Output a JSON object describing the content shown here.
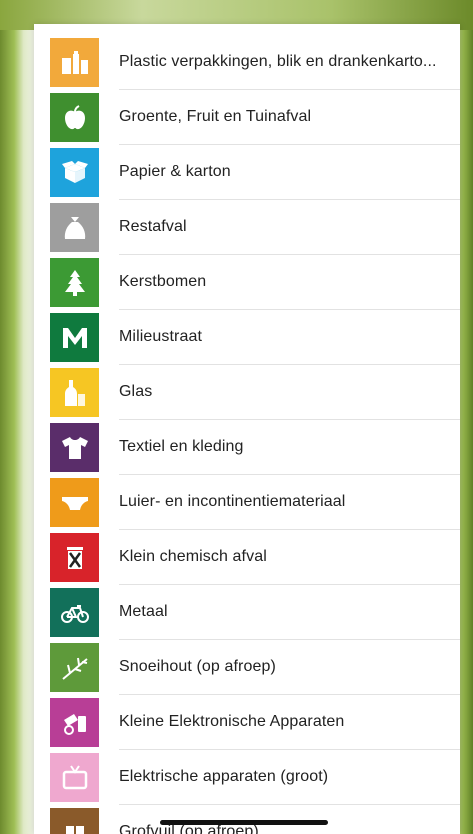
{
  "items": [
    {
      "label": "Plastic verpakkingen, blik en drankenkarto...",
      "icon": "packaging-icon",
      "color": "#f2a93b"
    },
    {
      "label": "Groente, Fruit en Tuinafval",
      "icon": "apple-icon",
      "color": "#3f8f2f"
    },
    {
      "label": "Papier & karton",
      "icon": "box-icon",
      "color": "#1ea3dc"
    },
    {
      "label": "Restafval",
      "icon": "trash-bag-icon",
      "color": "#9e9e9e"
    },
    {
      "label": "Kerstbomen",
      "icon": "christmas-tree-icon",
      "color": "#3c9a34"
    },
    {
      "label": "Milieustraat",
      "icon": "m-logo-icon",
      "color": "#0f7a3e"
    },
    {
      "label": "Glas",
      "icon": "bottle-icon",
      "color": "#f6c623"
    },
    {
      "label": "Textiel en kleding",
      "icon": "tshirt-icon",
      "color": "#5a2d6a"
    },
    {
      "label": "Luier- en incontinentiemateriaal",
      "icon": "diaper-icon",
      "color": "#ef9b1a"
    },
    {
      "label": "Klein chemisch afval",
      "icon": "chemical-bin-icon",
      "color": "#d8232a"
    },
    {
      "label": "Metaal",
      "icon": "bicycle-icon",
      "color": "#12705a"
    },
    {
      "label": "Snoeihout (op afroep)",
      "icon": "branch-icon",
      "color": "#5e9a3a"
    },
    {
      "label": "Kleine Elektronische Apparaten",
      "icon": "small-electronics-icon",
      "color": "#b83e96"
    },
    {
      "label": "Elektrische apparaten (groot)",
      "icon": "tv-icon",
      "color": "#efa8cf"
    },
    {
      "label": "Grofvuil (op afroep)",
      "icon": "sofa-icon",
      "color": "#8a5a2a"
    }
  ]
}
